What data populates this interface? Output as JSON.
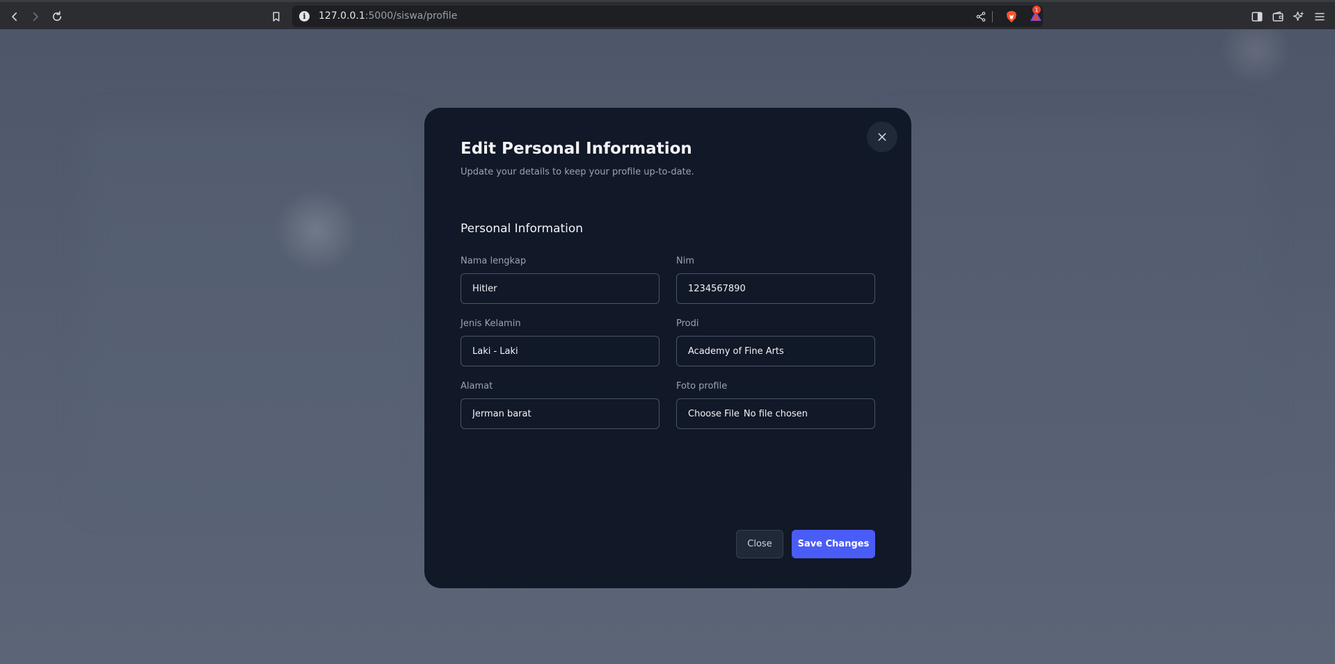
{
  "browser": {
    "url_host": "127.0.0.1",
    "url_path": ":5000/siswa/profile",
    "rewards_badge": "1"
  },
  "modal": {
    "title": "Edit Personal Information",
    "subtitle": "Update your details to keep your profile up-to-date.",
    "section_title": "Personal Information",
    "fields": {
      "nama": {
        "label": "Nama lengkap",
        "value": "Hitler"
      },
      "nim": {
        "label": "Nim",
        "value": "1234567890"
      },
      "jenis_kelamin": {
        "label": "Jenis Kelamin",
        "value": "Laki - Laki"
      },
      "prodi": {
        "label": "Prodi",
        "value": "Academy of Fine Arts"
      },
      "alamat": {
        "label": "Alamat",
        "value": "Jerman barat"
      },
      "foto": {
        "label": "Foto profile",
        "button": "Choose File",
        "status": "No file chosen"
      }
    },
    "buttons": {
      "close": "Close",
      "save": "Save Changes"
    }
  },
  "colors": {
    "accent": "#4a5cf6",
    "modal_bg": "#111827",
    "overlay": "#5a6376"
  }
}
